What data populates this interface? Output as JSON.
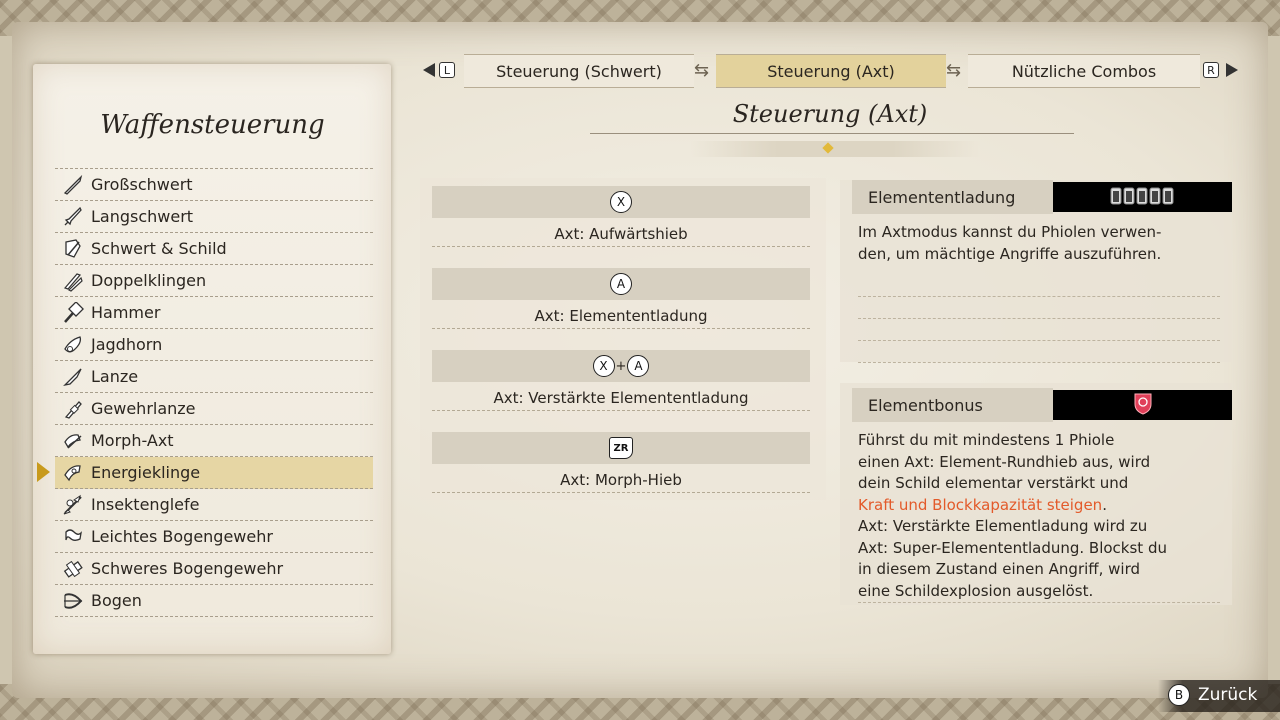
{
  "left_panel": {
    "title": "Waffensteuerung",
    "weapons": [
      {
        "label": "Großschwert",
        "icon": "greatsword-icon"
      },
      {
        "label": "Langschwert",
        "icon": "longsword-icon"
      },
      {
        "label": "Schwert & Schild",
        "icon": "sword-shield-icon"
      },
      {
        "label": "Doppelklingen",
        "icon": "dual-blades-icon"
      },
      {
        "label": "Hammer",
        "icon": "hammer-icon"
      },
      {
        "label": "Jagdhorn",
        "icon": "hunting-horn-icon"
      },
      {
        "label": "Lanze",
        "icon": "lance-icon"
      },
      {
        "label": "Gewehrlanze",
        "icon": "gunlance-icon"
      },
      {
        "label": "Morph-Axt",
        "icon": "switch-axe-icon"
      },
      {
        "label": "Energieklinge",
        "icon": "charge-blade-icon",
        "selected": true
      },
      {
        "label": "Insektenglefe",
        "icon": "insect-glaive-icon"
      },
      {
        "label": "Leichtes Bogengewehr",
        "icon": "light-bowgun-icon"
      },
      {
        "label": "Schweres Bogengewehr",
        "icon": "heavy-bowgun-icon"
      },
      {
        "label": "Bogen",
        "icon": "bow-icon"
      }
    ]
  },
  "tabs": {
    "left_shoulder": "L",
    "right_shoulder": "R",
    "items": [
      {
        "label": "Steuerung (Schwert)",
        "active": false
      },
      {
        "label": "Steuerung (Axt)",
        "active": true
      },
      {
        "label": "Nützliche Combos",
        "active": false
      }
    ]
  },
  "section_title": "Steuerung (Axt)",
  "controls": [
    {
      "buttons": [
        "X"
      ],
      "label": "Axt: Aufwärtshieb"
    },
    {
      "buttons": [
        "A"
      ],
      "label": "Axt: Elemententladung"
    },
    {
      "buttons": [
        "X",
        "+",
        "A"
      ],
      "label": "Axt: Verstärkte Elemententladung"
    },
    {
      "buttons": [
        "ZR"
      ],
      "label": "Axt: Morph-Hieb"
    }
  ],
  "info": {
    "elemententladung": {
      "title": "Elemententladung",
      "icon": "phial-vials-icon",
      "lines": [
        "Im Axtmodus kannst du Phiolen verwen-",
        "den, um mächtige Angriffe auszuführen."
      ]
    },
    "elementbonus": {
      "title": "Elementbonus",
      "icon": "red-shield-icon",
      "lines": [
        "Führst du mit mindestens 1 Phiole",
        "einen Axt: Element-Rundhieb aus, wird",
        "dein Schild elementar verstärkt und",
        "Kraft und Blockkapazität steigen.",
        "Axt: Verstärkte Elementladung wird zu",
        "Axt: Super-Elemententladung. Blockst du",
        "in diesem Zustand einen Angriff, wird",
        "eine Schildexplosion ausgelöst."
      ],
      "highlight_line_index": 3,
      "highlight_text": "Kraft und Blockkapazität steigen",
      "highlight_color": "#e35a2a"
    }
  },
  "footer": {
    "back_button_glyph": "B",
    "back_label": "Zurück"
  },
  "colors": {
    "selected_row": "#e6d6a4",
    "active_tab": "#e3d29c",
    "selector_arrow": "#c89a1c"
  }
}
